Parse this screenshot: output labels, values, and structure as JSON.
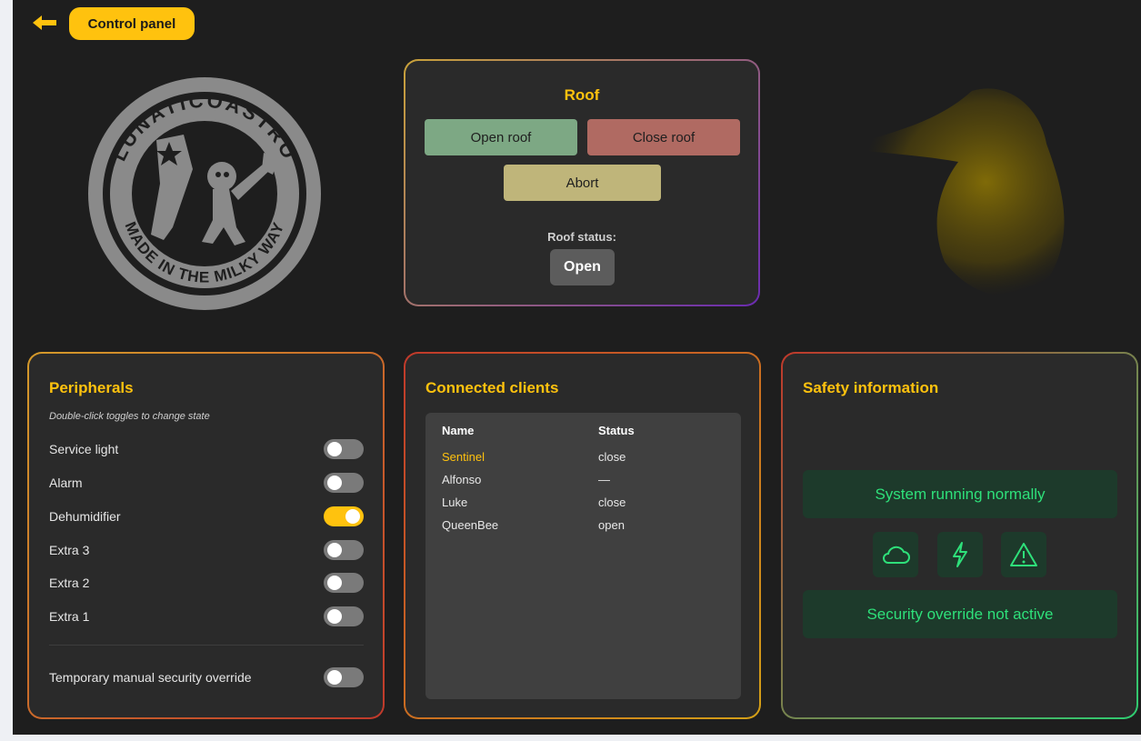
{
  "header": {
    "title": "Control panel"
  },
  "logo": {
    "text_top": "LUNATICOASTRO",
    "text_bottom": "MADE IN THE MILKY WAY"
  },
  "roof": {
    "title": "Roof",
    "open_label": "Open roof",
    "close_label": "Close roof",
    "abort_label": "Abort",
    "status_label": "Roof status:",
    "status_value": "Open"
  },
  "peripherals": {
    "title": "Peripherals",
    "hint": "Double-click toggles to change state",
    "items": [
      {
        "label": "Service light",
        "on": false
      },
      {
        "label": "Alarm",
        "on": false
      },
      {
        "label": "Dehumidifier",
        "on": true
      },
      {
        "label": "Extra 3",
        "on": false
      },
      {
        "label": "Extra 2",
        "on": false
      },
      {
        "label": "Extra 1",
        "on": false
      }
    ],
    "override": {
      "label": "Temporary manual security override",
      "on": false
    }
  },
  "clients": {
    "title": "Connected clients",
    "columns": [
      "Name",
      "Status"
    ],
    "rows": [
      {
        "name": "Sentinel",
        "status": "close"
      },
      {
        "name": "Alfonso",
        "status": "—"
      },
      {
        "name": "Luke",
        "status": "close"
      },
      {
        "name": "QueenBee",
        "status": "open"
      }
    ]
  },
  "safety": {
    "title": "Safety information",
    "status": "System running normally",
    "icons": [
      "cloud-icon",
      "lightning-icon",
      "warning-icon"
    ],
    "override_status": "Security override not active"
  },
  "colors": {
    "accent": "#ffc20e",
    "safe": "#2ee07a"
  }
}
